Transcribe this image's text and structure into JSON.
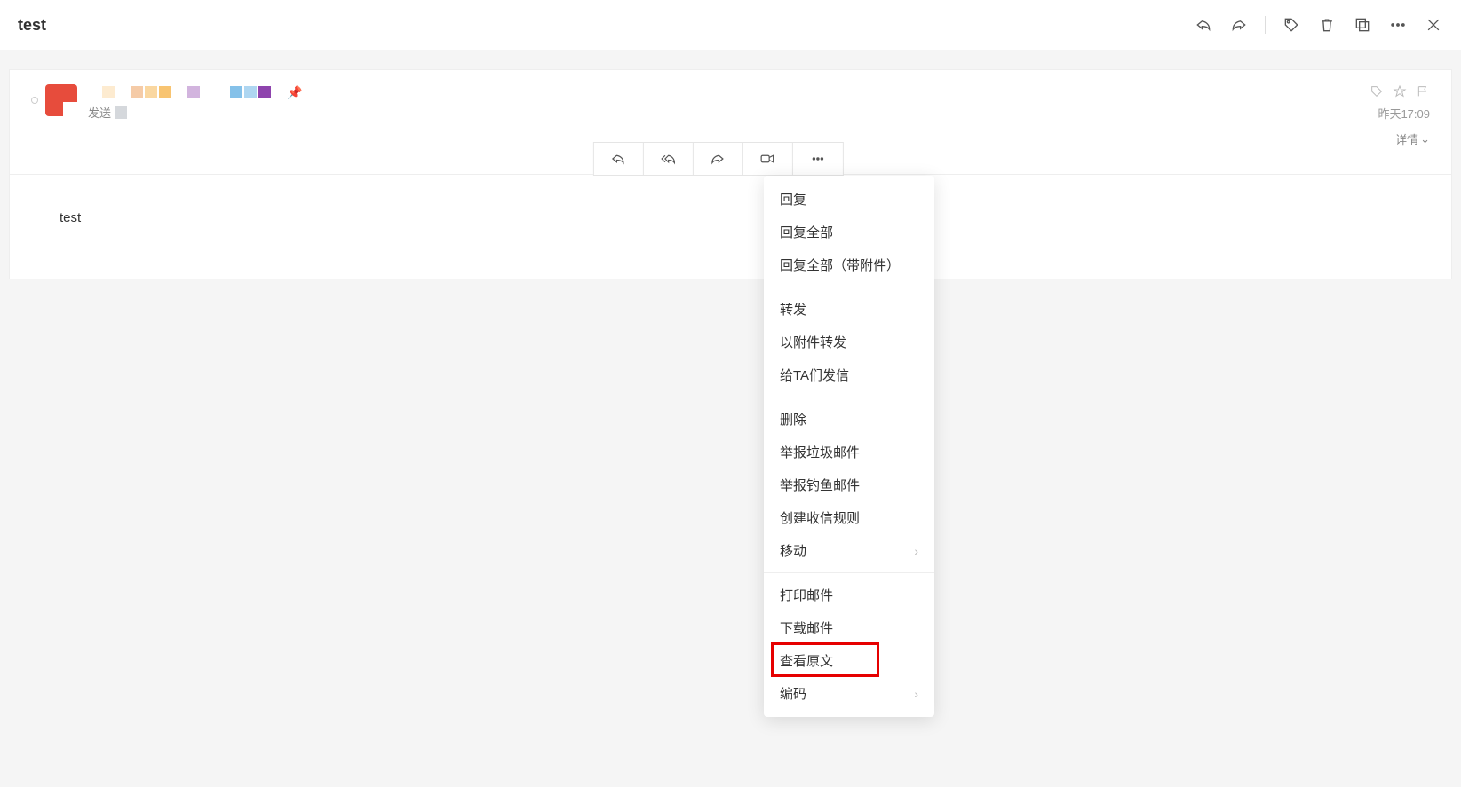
{
  "subject": "test",
  "send_to_prefix": "发送",
  "timestamp": "昨天17:09",
  "details_label": "详情",
  "body_text": "test",
  "menu": {
    "g1": [
      "回复",
      "回复全部",
      "回复全部（带附件）"
    ],
    "g2": [
      "转发",
      "以附件转发",
      "给TA们发信"
    ],
    "g3": [
      "删除",
      "举报垃圾邮件",
      "举报钓鱼邮件",
      "创建收信规则",
      "移动"
    ],
    "g4": [
      "打印邮件",
      "下载邮件",
      "查看原文",
      "编码"
    ]
  },
  "highlighted_item": "查看原文",
  "submenu_items": [
    "移动",
    "编码"
  ]
}
